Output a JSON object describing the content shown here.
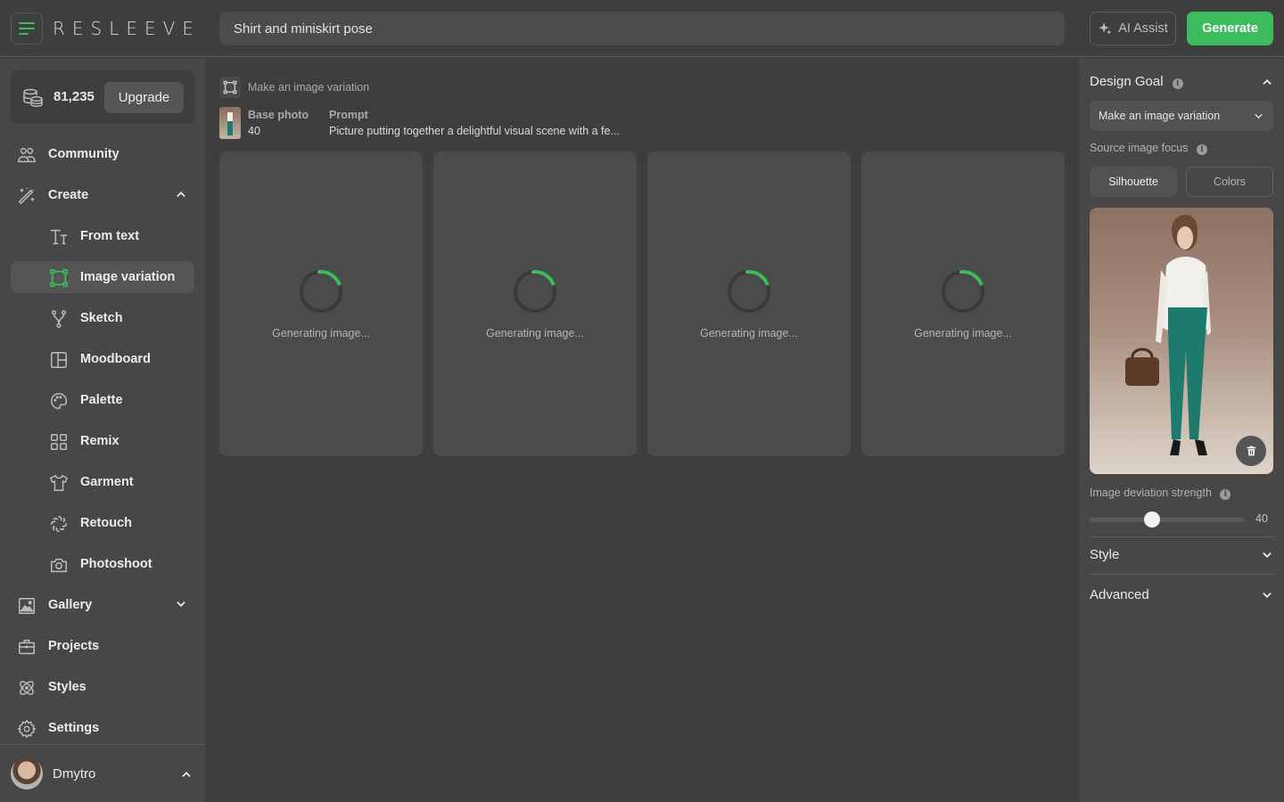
{
  "app": {
    "logo": "RESLEEVE"
  },
  "topbar": {
    "prompt_value": "Shirt and miniskirt pose",
    "ai_assist_label": "AI Assist",
    "generate_label": "Generate"
  },
  "sidebar": {
    "credits": "81,235",
    "upgrade_label": "Upgrade",
    "items": [
      {
        "label": "Community",
        "icon": "community-icon"
      },
      {
        "label": "Create",
        "icon": "magic-wand-icon",
        "expanded": true
      },
      {
        "label": "From text",
        "icon": "text-icon"
      },
      {
        "label": "Image variation",
        "icon": "image-variation-icon",
        "active": true
      },
      {
        "label": "Sketch",
        "icon": "sketch-icon"
      },
      {
        "label": "Moodboard",
        "icon": "moodboard-icon"
      },
      {
        "label": "Palette",
        "icon": "palette-icon"
      },
      {
        "label": "Remix",
        "icon": "remix-icon"
      },
      {
        "label": "Garment",
        "icon": "garment-icon"
      },
      {
        "label": "Retouch",
        "icon": "retouch-icon"
      },
      {
        "label": "Photoshoot",
        "icon": "camera-icon"
      },
      {
        "label": "Gallery",
        "icon": "gallery-icon",
        "expanded": false
      },
      {
        "label": "Projects",
        "icon": "briefcase-icon"
      },
      {
        "label": "Styles",
        "icon": "styles-icon"
      },
      {
        "label": "Settings",
        "icon": "gear-icon"
      }
    ],
    "user": {
      "name": "Dmytro"
    }
  },
  "main": {
    "goal_label": "Make an image variation",
    "base_photo_label": "Base photo",
    "base_photo_value": "40",
    "prompt_label": "Prompt",
    "prompt_value": "Picture putting together a delightful visual scene with a fe...",
    "cards": [
      {
        "status": "Generating image...",
        "progress": 0.2
      },
      {
        "status": "Generating image...",
        "progress": 0.2
      },
      {
        "status": "Generating image...",
        "progress": 0.2
      },
      {
        "status": "Generating image...",
        "progress": 0.2
      }
    ],
    "accent": "#3cbc5c"
  },
  "right_panel": {
    "design_goal_title": "Design Goal",
    "design_goal_value": "Make an image variation",
    "source_focus_label": "Source image focus",
    "focus_options": [
      "Silhouette",
      "Colors"
    ],
    "focus_selected": "Silhouette",
    "deviation_label": "Image deviation strength",
    "deviation_value": "40",
    "deviation_fraction": 0.4,
    "style_title": "Style",
    "advanced_title": "Advanced"
  }
}
